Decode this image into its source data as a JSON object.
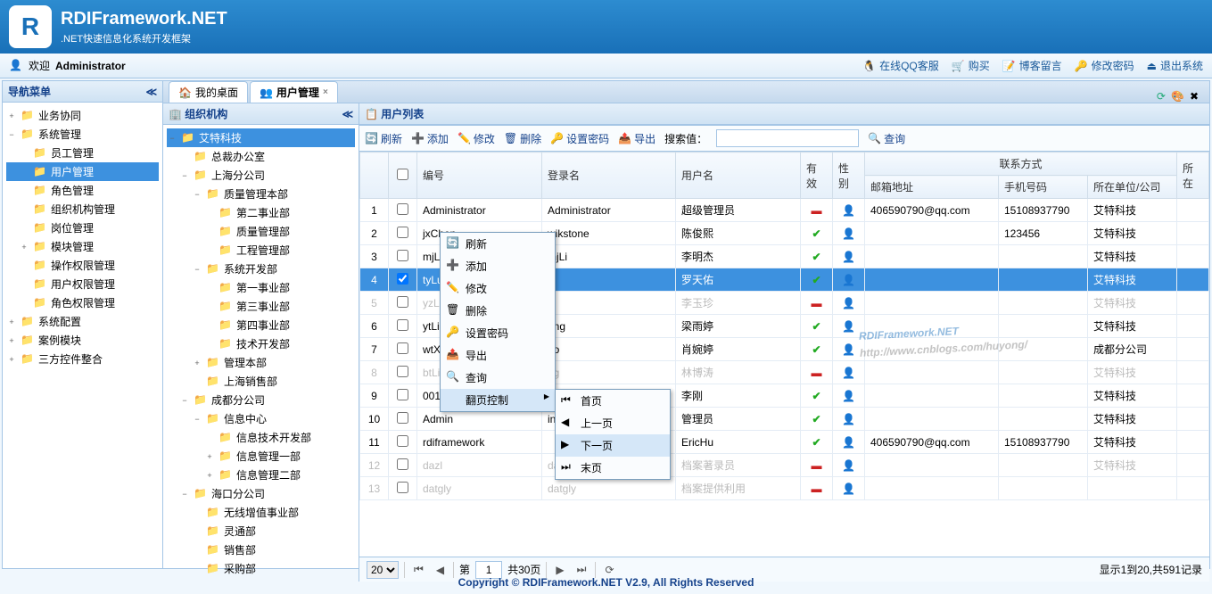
{
  "header": {
    "product": "RDIFramework.NET",
    "subtitle": ".NET快速信息化系统开发框架"
  },
  "welcome": {
    "prefix": "欢迎",
    "user": "Administrator",
    "links": {
      "qq": "在线QQ客服",
      "cart": "购买",
      "blog": "博客留言",
      "password": "修改密码",
      "exit": "退出系统"
    }
  },
  "nav": {
    "title": "导航菜单",
    "items": [
      {
        "label": "业务协同",
        "depth": 0,
        "toggle": "+"
      },
      {
        "label": "系统管理",
        "depth": 0,
        "toggle": "−"
      },
      {
        "label": "员工管理",
        "depth": 1
      },
      {
        "label": "用户管理",
        "depth": 1,
        "selected": true
      },
      {
        "label": "角色管理",
        "depth": 1
      },
      {
        "label": "组织机构管理",
        "depth": 1
      },
      {
        "label": "岗位管理",
        "depth": 1
      },
      {
        "label": "模块管理",
        "depth": 1,
        "toggle": "+"
      },
      {
        "label": "操作权限管理",
        "depth": 1
      },
      {
        "label": "用户权限管理",
        "depth": 1
      },
      {
        "label": "角色权限管理",
        "depth": 1
      },
      {
        "label": "系统配置",
        "depth": 0,
        "toggle": "+"
      },
      {
        "label": "案例模块",
        "depth": 0,
        "toggle": "+"
      },
      {
        "label": "三方控件整合",
        "depth": 0,
        "toggle": "+"
      }
    ]
  },
  "tabs": {
    "desktop": "我的桌面",
    "user": "用户管理"
  },
  "org": {
    "title": "组织机构",
    "items": [
      {
        "label": "艾特科技",
        "depth": 0,
        "toggle": "−",
        "selected": true
      },
      {
        "label": "总裁办公室",
        "depth": 1
      },
      {
        "label": "上海分公司",
        "depth": 1,
        "toggle": "−"
      },
      {
        "label": "质量管理本部",
        "depth": 2,
        "toggle": "−"
      },
      {
        "label": "第二事业部",
        "depth": 3
      },
      {
        "label": "质量管理部",
        "depth": 3
      },
      {
        "label": "工程管理部",
        "depth": 3
      },
      {
        "label": "系统开发部",
        "depth": 2,
        "toggle": "−"
      },
      {
        "label": "第一事业部",
        "depth": 3
      },
      {
        "label": "第三事业部",
        "depth": 3
      },
      {
        "label": "第四事业部",
        "depth": 3
      },
      {
        "label": "技术开发部",
        "depth": 3
      },
      {
        "label": "管理本部",
        "depth": 2,
        "toggle": "+"
      },
      {
        "label": "上海销售部",
        "depth": 2
      },
      {
        "label": "成都分公司",
        "depth": 1,
        "toggle": "−"
      },
      {
        "label": "信息中心",
        "depth": 2,
        "toggle": "−"
      },
      {
        "label": "信息技术开发部",
        "depth": 3
      },
      {
        "label": "信息管理一部",
        "depth": 3,
        "toggle": "+"
      },
      {
        "label": "信息管理二部",
        "depth": 3,
        "toggle": "+"
      },
      {
        "label": "海口分公司",
        "depth": 1,
        "toggle": "−"
      },
      {
        "label": "无线增值事业部",
        "depth": 2
      },
      {
        "label": "灵通部",
        "depth": 2
      },
      {
        "label": "销售部",
        "depth": 2
      },
      {
        "label": "采购部",
        "depth": 2
      }
    ]
  },
  "listTitle": "用户列表",
  "toolbar": {
    "refresh": "刷新",
    "add": "添加",
    "edit": "修改",
    "delete": "删除",
    "setpwd": "设置密码",
    "export": "导出",
    "search_label": "搜索值：",
    "search_btn": "查询"
  },
  "columns": {
    "num": "编号",
    "login": "登录名",
    "name": "用户名",
    "valid": "有效",
    "gender": "性别",
    "contact_group": "联系方式",
    "email": "邮箱地址",
    "mobile": "手机号码",
    "company": "所在单位/公司",
    "dept": "所在"
  },
  "rows": [
    {
      "n": 1,
      "login": "Administrator",
      "name": "Administrator",
      "user": "超级管理员",
      "valid": "-",
      "email": "406590790@qq.com",
      "mobile": "15108937790",
      "company": "艾特科技"
    },
    {
      "n": 2,
      "login": "jxChen",
      "name": "wikstone",
      "user": "陈俊熙",
      "valid": "✔",
      "email": "",
      "mobile": "123456",
      "company": "艾特科技"
    },
    {
      "n": 3,
      "login": "mjLi",
      "name": "mjLi",
      "user": "李明杰",
      "valid": "✔",
      "email": "",
      "mobile": "",
      "company": "艾特科技"
    },
    {
      "n": 4,
      "login": "tyLuo",
      "name": "",
      "user": "罗天佑",
      "valid": "✔",
      "email": "",
      "mobile": "",
      "company": "艾特科技",
      "selected": true
    },
    {
      "n": 5,
      "login": "yzLi",
      "name": "",
      "user": "李玉珍",
      "valid": "-",
      "email": "",
      "mobile": "",
      "company": "艾特科技",
      "disabled": true
    },
    {
      "n": 6,
      "login": "ytLiang",
      "name": "ang",
      "user": "梁雨婷",
      "valid": "✔",
      "email": "",
      "mobile": "",
      "company": "艾特科技"
    },
    {
      "n": 7,
      "login": "wtXiao",
      "name": "ao",
      "user": "肖婉婷",
      "valid": "✔",
      "email": "",
      "mobile": "",
      "company": "成都分公司"
    },
    {
      "n": 8,
      "login": "btLing",
      "name": "ng",
      "user": "林博涛",
      "valid": "-",
      "email": "",
      "mobile": "",
      "company": "艾特科技",
      "disabled": true
    },
    {
      "n": 9,
      "login": "0015",
      "name": "ng",
      "user": "李刚",
      "valid": "✔",
      "email": "",
      "mobile": "",
      "company": "艾特科技"
    },
    {
      "n": 10,
      "login": "Admin",
      "name": "in",
      "user": "管理员",
      "valid": "✔",
      "email": "",
      "mobile": "",
      "company": "艾特科技"
    },
    {
      "n": 11,
      "login": "rdiframework",
      "name": "",
      "user": "EricHu",
      "valid": "✔",
      "email": "406590790@qq.com",
      "mobile": "15108937790",
      "company": "艾特科技"
    },
    {
      "n": 12,
      "login": "dazl",
      "name": "dazl",
      "user": "档案著录员",
      "valid": "-",
      "email": "",
      "mobile": "",
      "company": "艾特科技",
      "disabled": true
    },
    {
      "n": 13,
      "login": "datgly",
      "name": "datgly",
      "user": "档案提供利用",
      "valid": "-",
      "email": "",
      "mobile": "",
      "company": "",
      "disabled": true
    }
  ],
  "context_menu": {
    "refresh": "刷新",
    "add": "添加",
    "edit": "修改",
    "delete": "删除",
    "setpwd": "设置密码",
    "export": "导出",
    "search": "查询",
    "paging": "翻页控制",
    "first": "首页",
    "prev": "上一页",
    "next": "下一页",
    "last": "末页"
  },
  "pager": {
    "pagesize": "20",
    "page_prefix": "第",
    "page": "1",
    "total_pages": "共30页",
    "info": "显示1到20,共591记录"
  },
  "watermark": {
    "title": "RDIFramework.NET",
    "url": "http://www.cnblogs.com/huyong/"
  },
  "footer": "Copyright © RDIFramework.NET V2.9, All Rights Reserved"
}
